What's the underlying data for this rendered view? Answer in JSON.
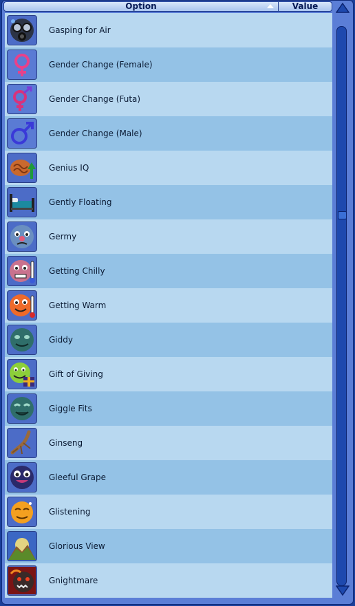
{
  "header": {
    "option_label": "Option",
    "value_label": "Value"
  },
  "colors": {
    "frame": "#5b7ed6",
    "row_light": "#b8d8f0",
    "row_dark": "#94c2e6",
    "tile": "#4c6cc7",
    "scroll_track": "#1e49ae"
  },
  "rows": [
    {
      "label": "Gasping for Air",
      "icon": "gas-mask-face-icon"
    },
    {
      "label": "Gender Change (Female)",
      "icon": "female-symbol-icon"
    },
    {
      "label": "Gender Change (Futa)",
      "icon": "futa-symbol-icon"
    },
    {
      "label": "Gender Change (Male)",
      "icon": "male-symbol-icon"
    },
    {
      "label": "Genius IQ",
      "icon": "brain-up-arrow-icon"
    },
    {
      "label": "Gently Floating",
      "icon": "floating-bed-icon"
    },
    {
      "label": "Germy",
      "icon": "sick-face-icon"
    },
    {
      "label": "Getting Chilly",
      "icon": "cold-face-thermometer-icon"
    },
    {
      "label": "Getting Warm",
      "icon": "warm-face-thermometer-icon"
    },
    {
      "label": "Giddy",
      "icon": "giddy-face-icon"
    },
    {
      "label": "Gift of Giving",
      "icon": "face-with-gift-icon"
    },
    {
      "label": "Giggle Fits",
      "icon": "giggle-face-icon"
    },
    {
      "label": "Ginseng",
      "icon": "ginseng-root-icon"
    },
    {
      "label": "Gleeful Grape",
      "icon": "grape-face-icon"
    },
    {
      "label": "Glistening",
      "icon": "sweaty-sun-face-icon"
    },
    {
      "label": "Glorious View",
      "icon": "mountain-view-icon"
    },
    {
      "label": "Gnightmare",
      "icon": "nightmare-face-icon"
    }
  ],
  "scrollbar": {
    "position_fraction": 0.33
  }
}
